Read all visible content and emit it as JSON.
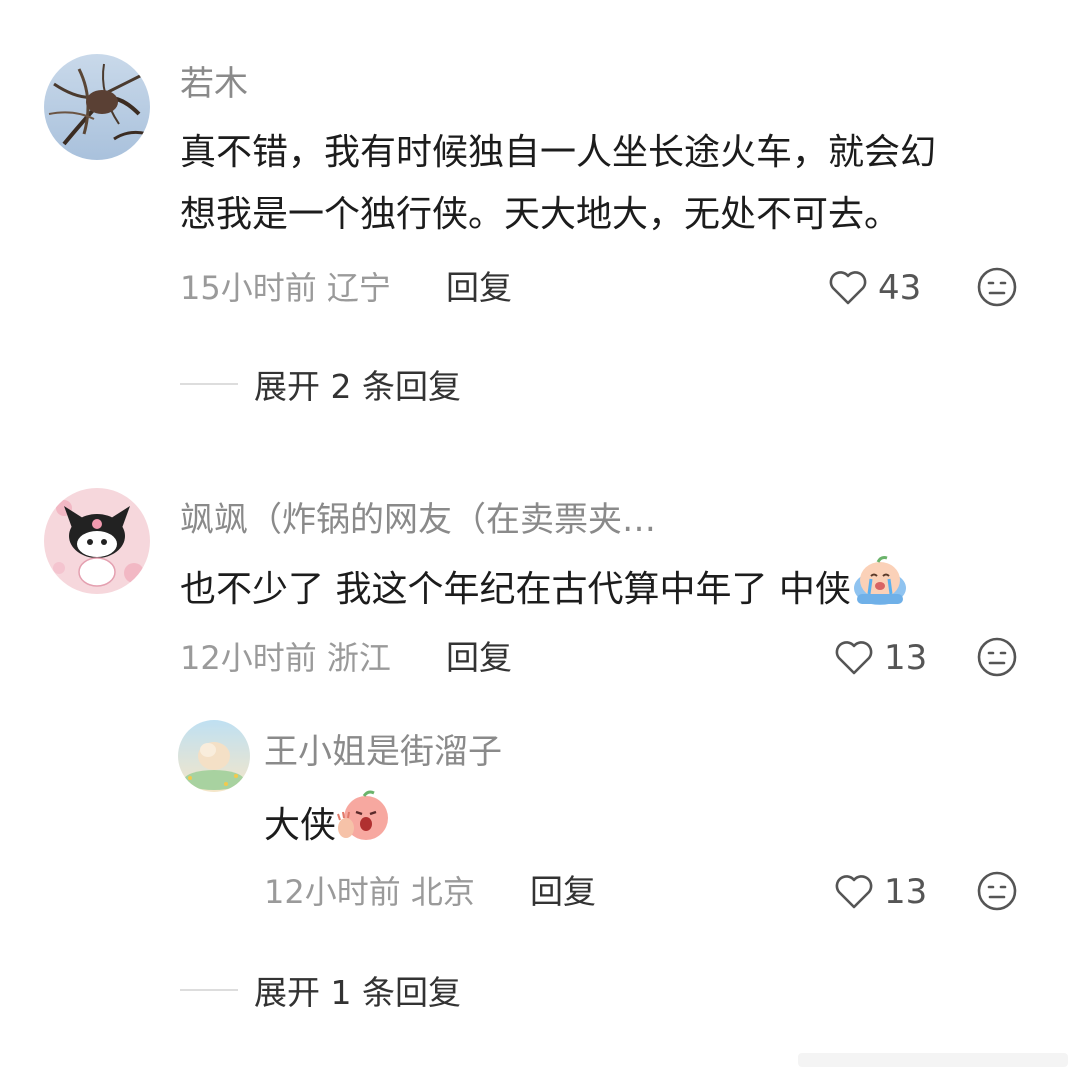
{
  "comments": [
    {
      "username": "若木",
      "text_line1": "真不错，我有时候独自一人坐长途火车，就会幻",
      "text_line2": "想我是一个独行侠。天大地大，无处不可去。",
      "meta": "15小时前 辽宁",
      "reply_label": "回复",
      "likes": "43",
      "expand_label": "展开 2 条回复"
    },
    {
      "username": "飒飒（炸锅的网友（在卖票夹…",
      "text": "也不少了 我这个年纪在古代算中年了 中侠",
      "meta": "12小时前 浙江",
      "reply_label": "回复",
      "likes": "13",
      "reply": {
        "username": "王小姐是街溜子",
        "text": "大侠",
        "meta": "12小时前 北京",
        "reply_label": "回复",
        "likes": "13"
      },
      "expand_label": "展开 1 条回复"
    }
  ],
  "icons": {
    "like": "heart-outline-icon",
    "dislike": "neutral-face-icon",
    "emoji_cry": "crying-peach-emoji",
    "emoji_shock": "shocked-peach-emoji"
  },
  "colors": {
    "username": "#8a8a8a",
    "meta": "#9a9a9a",
    "text": "#1c1c1c"
  }
}
